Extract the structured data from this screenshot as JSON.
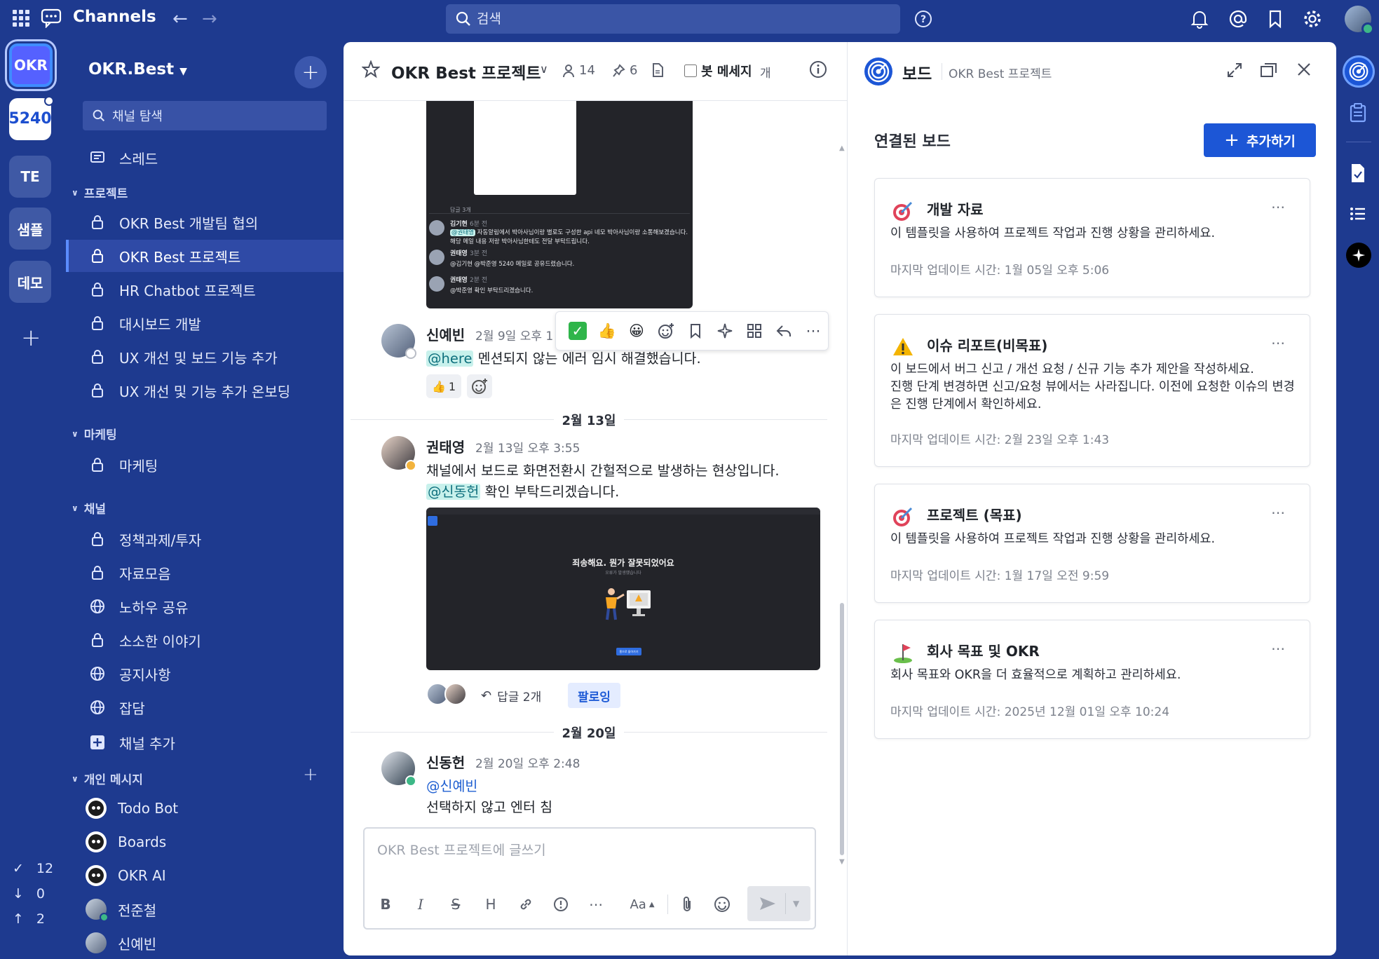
{
  "topbar": {
    "title": "Channels",
    "search_placeholder": "검색"
  },
  "teams": [
    {
      "label": "OKR"
    },
    {
      "label": "5240"
    },
    {
      "label": "TE"
    },
    {
      "label": "샘플"
    },
    {
      "label": "데모"
    }
  ],
  "rail_stats": {
    "done": "12",
    "down": "0",
    "up": "2"
  },
  "sidebar": {
    "team_name": "OKR.Best",
    "find_placeholder": "채널 탐색",
    "threads_label": "스레드",
    "sections": {
      "project": "프로젝트",
      "marketing": "마케팅",
      "channels": "채널",
      "dm": "개인 메시지"
    },
    "project_items": [
      "OKR Best 개발팀 협의",
      "OKR Best 프로젝트",
      "HR Chatbot 프로젝트",
      "대시보드 개발",
      "UX 개선 및 보드 기능 추가",
      "UX 개선 및 기능 추가 온보딩"
    ],
    "marketing_items": [
      "마케팅"
    ],
    "channel_items": [
      "정책과제/투자",
      "자료모음",
      "노하우 공유",
      "소소한 이야기",
      "공지사항",
      "잡담"
    ],
    "add_channel": "채널 추가",
    "dm_items": [
      "Todo Bot",
      "Boards",
      "OKR AI",
      "전준철",
      "신예빈"
    ]
  },
  "channel": {
    "title": "OKR Best 프로젝트",
    "members": "14",
    "pinned": "6",
    "bot_label": "봇 메세지",
    "bot_suffix": "개"
  },
  "thumb_text": {
    "replies": "답글 3개",
    "r1_name": "김기현",
    "r1_time": "6분 전",
    "r1_mention": "@권태영",
    "r1_text": "자동알림에서 박아사님이랑 별로도 구성한 api 네모 박아사님이랑 소통해보겠습니다. 해당 메일 내용 저랑 박아사님한테도 전달 부탁드립니다.",
    "r2_name": "권태영",
    "r2_time": "3분 전",
    "r2_text": "@김기현 @박준영 5240 메일로 공유드렸습니다.",
    "r3_name": "권태영",
    "r3_time": "2분 전",
    "r3_text": "@박준영 확인 부탁드리겠습니다."
  },
  "messages": {
    "m1": {
      "author": "신예빈",
      "time": "2월 9일 오후 1",
      "mention": "@here",
      "text": "멘션되지 않는 에러 임시 해결했습니다.",
      "reaction_count": "1"
    },
    "sep1": "2월 13일",
    "m2": {
      "author": "권태영",
      "time": "2월 13일 오후 3:55",
      "line1": "채널에서 보드로 화면전환시 간헐적으로 발생하는 현상입니다.",
      "mention": "@신동헌",
      "line2": "확인 부탁드리겠습니다.",
      "img_text": "죄송해요. 뭔가 잘못되었어요",
      "img_sub": "오류가 발생했습니다",
      "img_btn": "홈으로 돌아가기",
      "replies": "답글 2개",
      "follow": "팔로잉"
    },
    "sep2": "2월 20일",
    "m3": {
      "author": "신동헌",
      "time": "2월 20일 오후 2:48",
      "mention": "@신예빈",
      "text": "선택하지 않고 엔터 침"
    }
  },
  "composer": {
    "placeholder": "OKR Best 프로젝트에 글쓰기",
    "font_label": "Aa"
  },
  "rhs": {
    "title": "보드",
    "subtitle": "OKR Best 프로젝트",
    "heading": "연결된 보드",
    "add_label": "추가하기",
    "cards": [
      {
        "title": "개발 자료",
        "desc": "이 템플릿을 사용하여 프로젝트 작업과 진행 상황을 관리하세요.",
        "updated": "마지막 업데이트 시간: 1월 05일 오후 5:06"
      },
      {
        "title": "이슈 리포트(비목표)",
        "desc": "이 보드에서 버그 신고 / 개선 요청 / 신규 기능 추가 제안을 작성하세요.\n진행 단계 변경하면 신고/요청 뷰에서는 사라집니다. 이전에 요청한 이슈의 변경은 진행 단계에서 확인하세요.",
        "updated": "마지막 업데이트 시간: 2월 23일 오후 1:43"
      },
      {
        "title": "프로젝트 (목표)",
        "desc": "이 템플릿을 사용하여 프로젝트 작업과 진행 상황을 관리하세요.",
        "updated": "마지막 업데이트 시간: 1월 17일 오전 9:59"
      },
      {
        "title": "회사 목표 및 OKR",
        "desc": "회사 목표와 OKR을 더 효율적으로 계획하고 관리하세요.",
        "updated": "마지막 업데이트 시간: 2025년 12월 01일 오후 10:24"
      }
    ]
  }
}
